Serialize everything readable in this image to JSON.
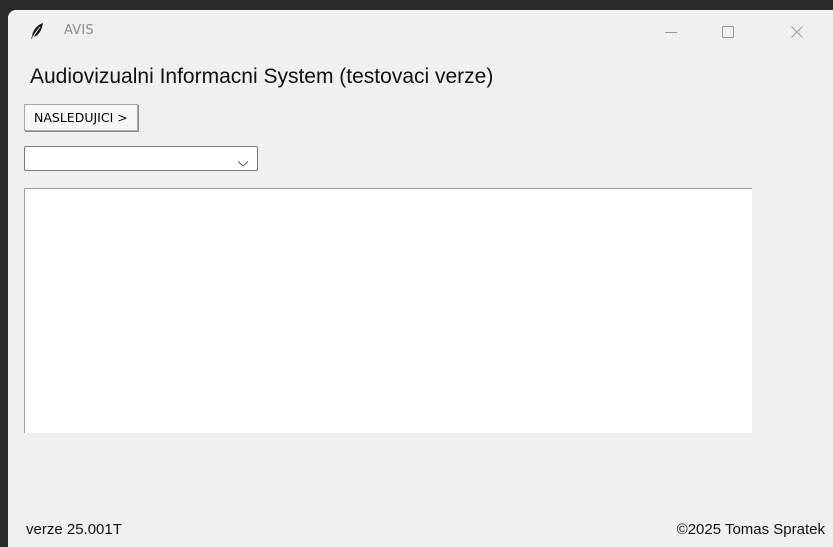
{
  "window": {
    "title": "AVIS",
    "app_icon": "feather-icon",
    "controls": {
      "minimize_icon": "minimize-icon",
      "maximize_icon": "maximize-icon",
      "close_icon": "close-icon"
    }
  },
  "main": {
    "heading": "Audiovizualni Informacni System (testovaci verze)",
    "next_button_label": "NASLEDUJICI >",
    "combo": {
      "value": "",
      "arrow_icon": "chevron-down-icon"
    },
    "text_area": {
      "value": ""
    }
  },
  "footer": {
    "version": "verze 25.001T",
    "copyright": "©2025 Tomas Spratek"
  }
}
